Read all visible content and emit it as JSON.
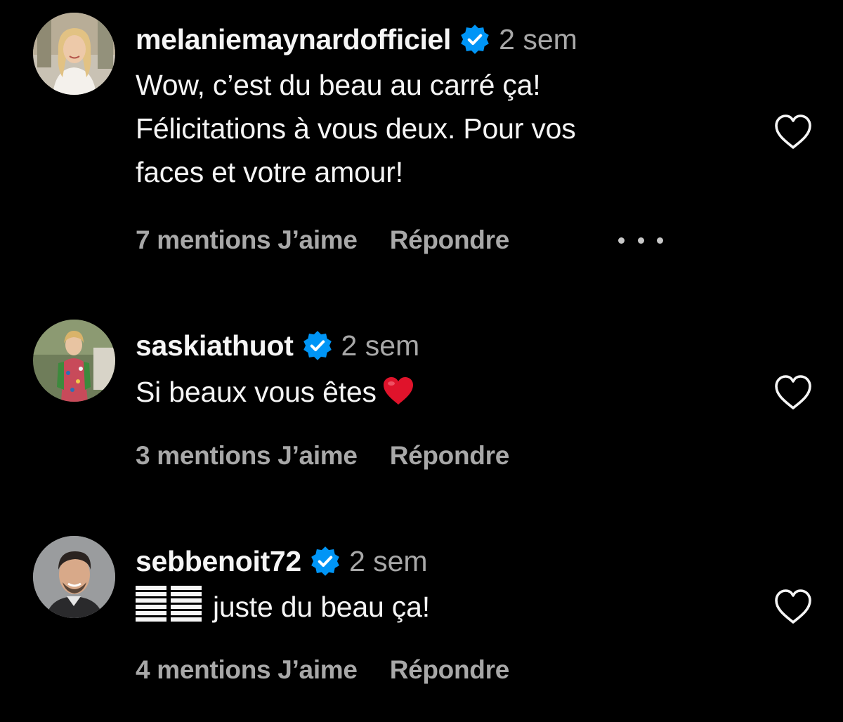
{
  "colors": {
    "background": "#000000",
    "text_primary": "#f5f5f5",
    "text_secondary": "#a8a8a8",
    "verified_blue": "#0095f6",
    "heart_outline": "#f5f5f5",
    "emoji_heart": "#e0132b"
  },
  "comments": [
    {
      "username": "melaniemaynardofficiel",
      "verified": true,
      "time": "2 sem",
      "text_lines": [
        "Wow, c’est du beau au carré ça!",
        "Félicitations à vous deux. Pour vos",
        "faces et votre amour!"
      ],
      "likes_label": "7 mentions J’aime",
      "reply_label": "Répondre",
      "has_more_menu": true,
      "avatar_icon": "avatar-photo-blonde-woman"
    },
    {
      "username": "saskiathuot",
      "verified": true,
      "time": "2 sem",
      "text": "Si beaux vous êtes",
      "text_emoji": "red-heart-emoji",
      "likes_label": "3 mentions J’aime",
      "reply_label": "Répondre",
      "avatar_icon": "avatar-photo-woman-floral-dress"
    },
    {
      "username": "sebbenoit72",
      "verified": true,
      "time": "2 sem",
      "text_prefix_icon": "hexagram-glyph",
      "text": "juste du beau ça!",
      "likes_label": "4 mentions J’aime",
      "reply_label": "Répondre",
      "avatar_icon": "avatar-photo-smiling-man"
    }
  ]
}
